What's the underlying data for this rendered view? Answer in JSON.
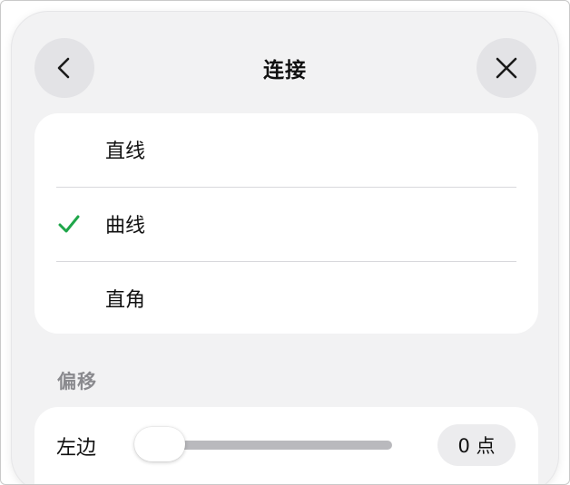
{
  "header": {
    "title": "连接",
    "back_icon": "chevron-left-icon",
    "close_icon": "close-icon"
  },
  "connection_options": {
    "items": [
      {
        "label": "直线",
        "selected": false
      },
      {
        "label": "曲线",
        "selected": true
      },
      {
        "label": "直角",
        "selected": false
      }
    ],
    "check_color": "#1fa64a"
  },
  "offset": {
    "section_title": "偏移",
    "side_label": "左边",
    "value_text": "0 点",
    "slider_fraction": 0
  }
}
